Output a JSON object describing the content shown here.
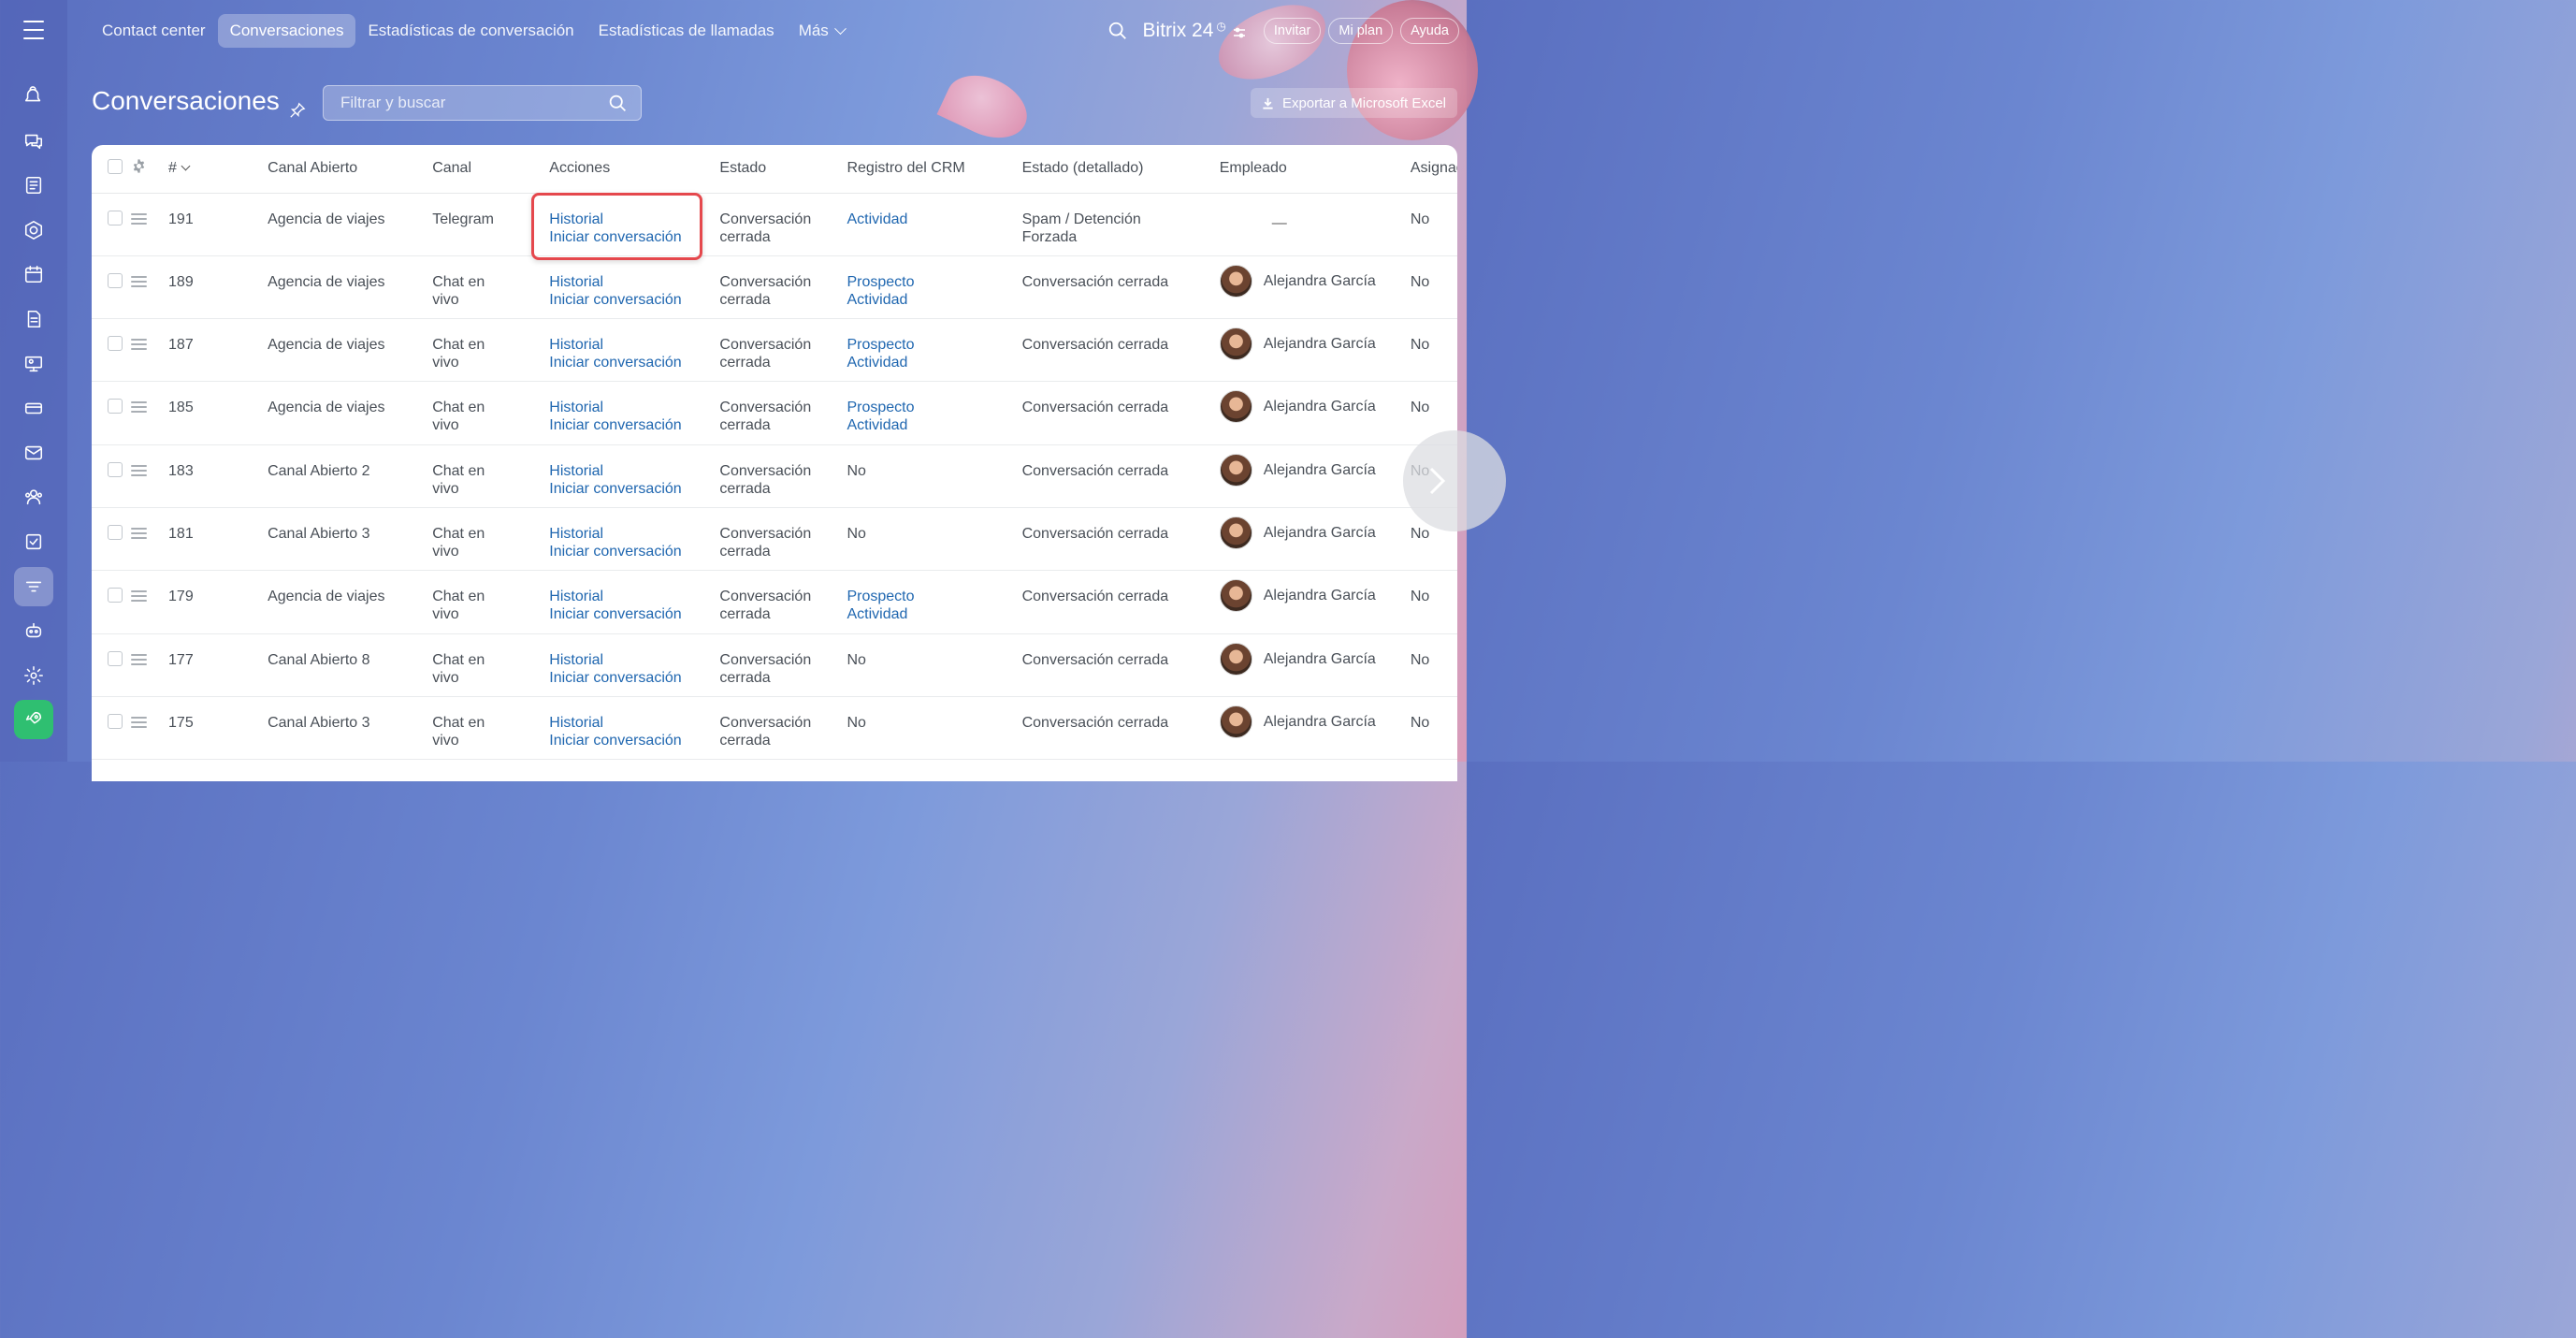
{
  "nav": {
    "items": [
      {
        "label": "Contact center",
        "active": false
      },
      {
        "label": "Conversaciones",
        "active": true
      },
      {
        "label": "Estadísticas de conversación",
        "active": false
      },
      {
        "label": "Estadísticas de llamadas",
        "active": false
      },
      {
        "label": "Más",
        "active": false
      }
    ],
    "brand": "Bitrix 24",
    "brand_clock": "◷",
    "invite": "Invitar",
    "plan": "Mi plan",
    "help": "Ayuda"
  },
  "sidebar": {
    "icons": [
      "feed-icon",
      "chat-icon",
      "tasks-list-icon",
      "crm-icon",
      "calendar-icon",
      "docs-icon",
      "sites-icon",
      "store-icon",
      "mail-icon",
      "contacts-icon",
      "checklist-icon",
      "contact-center-icon",
      "robot-icon",
      "settings-icon",
      "rocket-icon"
    ],
    "active": "contact-center-icon"
  },
  "page": {
    "title": "Conversaciones",
    "search_placeholder": "Filtrar y buscar",
    "export_label": "Exportar a Microsoft Excel"
  },
  "table": {
    "headers": {
      "num": "#",
      "canal_abierto": "Canal Abierto",
      "canal": "Canal",
      "acciones": "Acciones",
      "estado": "Estado",
      "crm": "Registro del CRM",
      "estado_det": "Estado (detallado)",
      "empleado": "Empleado",
      "asignado": "Asignad"
    },
    "action_labels": {
      "history": "Historial",
      "start": "Iniciar conversación"
    },
    "rows": [
      {
        "num": "191",
        "canal_abierto": "Agencia de viajes",
        "canal": [
          "Telegram"
        ],
        "estado": [
          "Conversación",
          "cerrada"
        ],
        "crm": {
          "links": [
            "Actividad"
          ],
          "text": ""
        },
        "estado_det": [
          "Spam / Detención",
          "Forzada"
        ],
        "empleado": "",
        "empty_mark": "—",
        "asignado": "No"
      },
      {
        "num": "189",
        "canal_abierto": "Agencia de viajes",
        "canal": [
          "Chat en",
          "vivo"
        ],
        "estado": [
          "Conversación",
          "cerrada"
        ],
        "crm": {
          "links": [
            "Prospecto",
            "Actividad"
          ],
          "text": ""
        },
        "estado_det": [
          "Conversación cerrada"
        ],
        "empleado": "Alejandra García",
        "asignado": "No"
      },
      {
        "num": "187",
        "canal_abierto": "Agencia de viajes",
        "canal": [
          "Chat en",
          "vivo"
        ],
        "estado": [
          "Conversación",
          "cerrada"
        ],
        "crm": {
          "links": [
            "Prospecto",
            "Actividad"
          ],
          "text": ""
        },
        "estado_det": [
          "Conversación cerrada"
        ],
        "empleado": "Alejandra García",
        "asignado": "No"
      },
      {
        "num": "185",
        "canal_abierto": "Agencia de viajes",
        "canal": [
          "Chat en",
          "vivo"
        ],
        "estado": [
          "Conversación",
          "cerrada"
        ],
        "crm": {
          "links": [
            "Prospecto",
            "Actividad"
          ],
          "text": ""
        },
        "estado_det": [
          "Conversación cerrada"
        ],
        "empleado": "Alejandra García",
        "asignado": "No"
      },
      {
        "num": "183",
        "canal_abierto": "Canal Abierto 2",
        "canal": [
          "Chat en",
          "vivo"
        ],
        "estado": [
          "Conversación",
          "cerrada"
        ],
        "crm": {
          "links": [],
          "text": "No"
        },
        "estado_det": [
          "Conversación cerrada"
        ],
        "empleado": "Alejandra García",
        "asignado": "No"
      },
      {
        "num": "181",
        "canal_abierto": "Canal Abierto 3",
        "canal": [
          "Chat en",
          "vivo"
        ],
        "estado": [
          "Conversación",
          "cerrada"
        ],
        "crm": {
          "links": [],
          "text": "No"
        },
        "estado_det": [
          "Conversación cerrada"
        ],
        "empleado": "Alejandra García",
        "asignado": "No"
      },
      {
        "num": "179",
        "canal_abierto": "Agencia de viajes",
        "canal": [
          "Chat en",
          "vivo"
        ],
        "estado": [
          "Conversación",
          "cerrada"
        ],
        "crm": {
          "links": [
            "Prospecto",
            "Actividad"
          ],
          "text": ""
        },
        "estado_det": [
          "Conversación cerrada"
        ],
        "empleado": "Alejandra García",
        "asignado": "No"
      },
      {
        "num": "177",
        "canal_abierto": "Canal Abierto 8",
        "canal": [
          "Chat en",
          "vivo"
        ],
        "estado": [
          "Conversación",
          "cerrada"
        ],
        "crm": {
          "links": [],
          "text": "No"
        },
        "estado_det": [
          "Conversación cerrada"
        ],
        "empleado": "Alejandra García",
        "asignado": "No"
      },
      {
        "num": "175",
        "canal_abierto": "Canal Abierto 3",
        "canal": [
          "Chat en",
          "vivo"
        ],
        "estado": [
          "Conversación",
          "cerrada"
        ],
        "crm": {
          "links": [],
          "text": "No"
        },
        "estado_det": [
          "Conversación cerrada"
        ],
        "empleado": "Alejandra García",
        "asignado": "No"
      }
    ]
  },
  "colors": {
    "link": "#2067b0",
    "highlight": "#e5484d",
    "active_green": "#2fbf71"
  }
}
